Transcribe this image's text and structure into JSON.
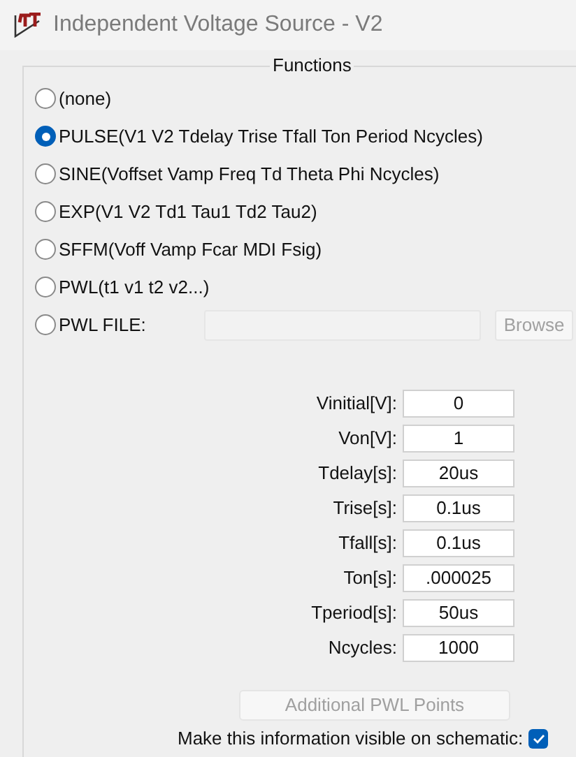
{
  "window": {
    "title": "Independent Voltage Source - V2"
  },
  "functions": {
    "title": "Functions",
    "options": [
      {
        "label": "(none)",
        "selected": false
      },
      {
        "label": "PULSE(V1 V2 Tdelay Trise Tfall Ton Period Ncycles)",
        "selected": true
      },
      {
        "label": "SINE(Voffset Vamp Freq Td Theta Phi Ncycles)",
        "selected": false
      },
      {
        "label": "EXP(V1 V2 Td1 Tau1 Td2 Tau2)",
        "selected": false
      },
      {
        "label": "SFFM(Voff Vamp Fcar MDI Fsig)",
        "selected": false
      },
      {
        "label": "PWL(t1 v1 t2 v2...)",
        "selected": false
      },
      {
        "label": "PWL FILE:",
        "selected": false
      }
    ],
    "file_button": {
      "label": "Browse",
      "disabled": true
    },
    "parameters": [
      {
        "label": "Vinitial[V]:",
        "value": "0"
      },
      {
        "label": "Von[V]:",
        "value": "1"
      },
      {
        "label": "Tdelay[s]:",
        "value": "20us"
      },
      {
        "label": "Trise[s]:",
        "value": "0.1us"
      },
      {
        "label": "Tfall[s]:",
        "value": "0.1us"
      },
      {
        "label": "Ton[s]:",
        "value": ".000025"
      },
      {
        "label": "Tperiod[s]:",
        "value": "50us"
      },
      {
        "label": "Ncycles:",
        "value": "1000"
      }
    ],
    "pwl_button": {
      "label": "Additional PWL Points",
      "disabled": true
    }
  },
  "visible_on_schematic": {
    "label": "Make this information visible on schematic:",
    "checked": true
  }
}
